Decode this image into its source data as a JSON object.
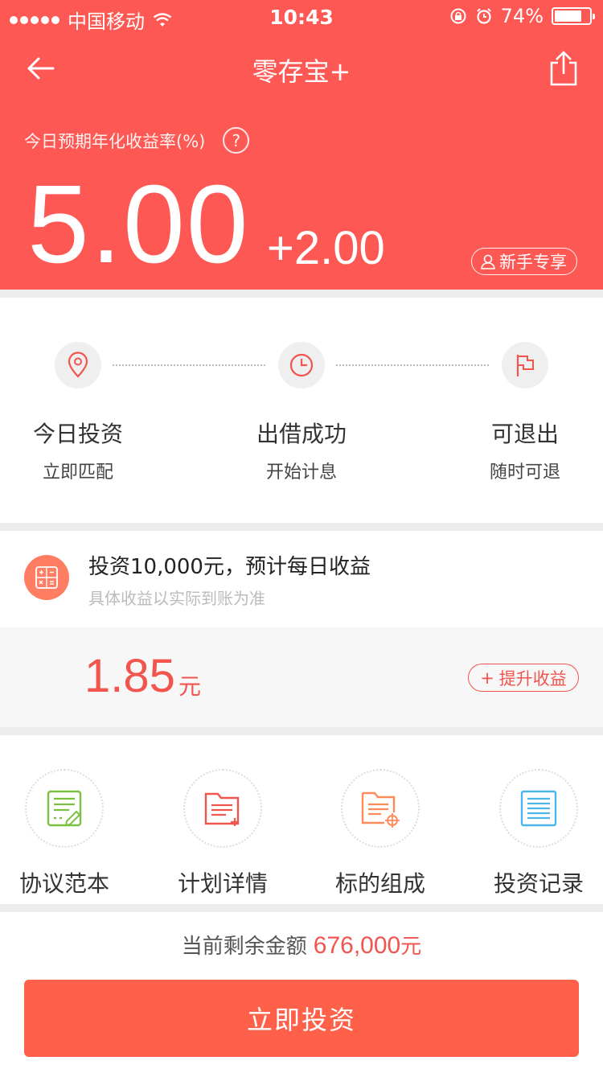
{
  "status_bar": {
    "carrier": "中国移动",
    "time": "10:43",
    "battery": "74%"
  },
  "nav": {
    "title": "零存宝+"
  },
  "rate": {
    "label": "今日预期年化收益率(%)",
    "help": "?",
    "value": "5.00",
    "bonus": "+2.00",
    "badge": "新手专享"
  },
  "steps": [
    {
      "title": "今日投资",
      "sub": "立即匹配",
      "icon": "location-pin-icon"
    },
    {
      "title": "出借成功",
      "sub": "开始计息",
      "icon": "clock-icon"
    },
    {
      "title": "可退出",
      "sub": "随时可退",
      "icon": "flag-icon"
    }
  ],
  "calculator": {
    "title": "投资10,000元，预计每日收益",
    "note": "具体收益以实际到账为准",
    "value": "1.85",
    "unit": "元",
    "boost_label": "提升收益",
    "boost_prefix": "+"
  },
  "links": [
    {
      "label": "协议范本",
      "icon": "agreement-doc-icon",
      "color": "#7ac143"
    },
    {
      "label": "计划详情",
      "icon": "plan-folder-icon",
      "color": "#f2544e"
    },
    {
      "label": "标的组成",
      "icon": "target-folder-icon",
      "color": "#fe8a5c"
    },
    {
      "label": "投资记录",
      "icon": "record-list-icon",
      "color": "#4db6e8"
    }
  ],
  "bottom": {
    "remain_label": "当前剩余金额",
    "remain_amount": "676,000",
    "remain_unit": "元",
    "invest_button": "立即投资"
  },
  "colors": {
    "brand_red": "#fe5854",
    "button_orange": "#fe6049",
    "accent_red": "#f2544e"
  }
}
